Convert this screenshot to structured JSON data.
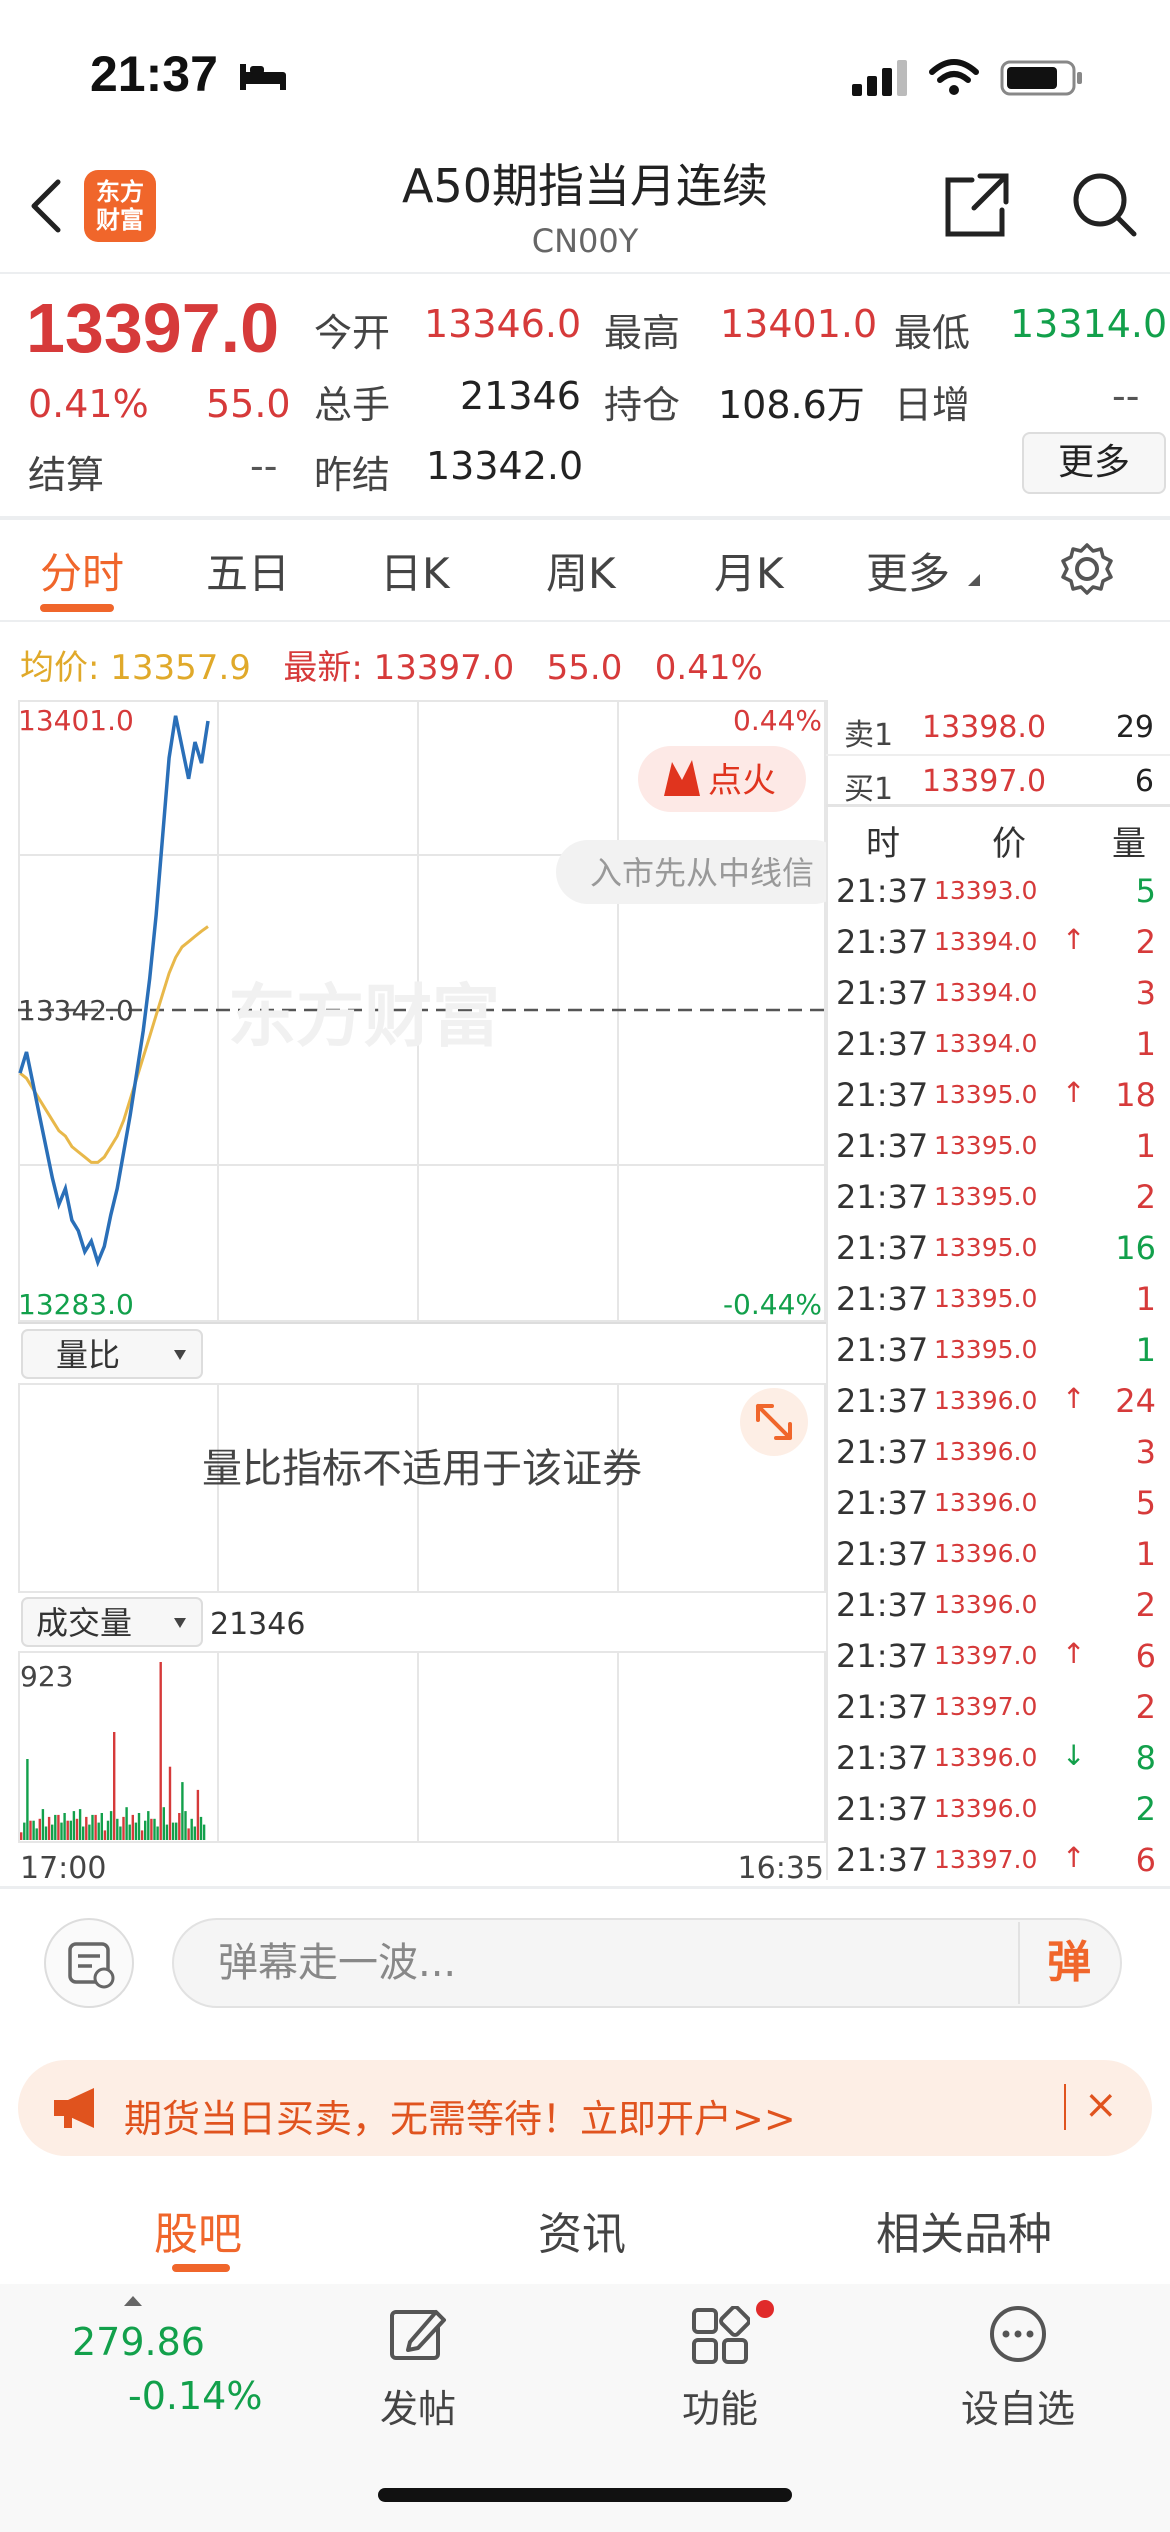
{
  "status_bar": {
    "time": "21:37"
  },
  "header": {
    "title": "A50期指当月连续",
    "code": "CN00Y",
    "logo_text_1": "东方",
    "logo_text_2": "财富"
  },
  "quote": {
    "last_price": "13397.0",
    "change_pct": "0.41%",
    "change": "55.0",
    "settle_label": "结算",
    "settle_value": "--",
    "open_label": "今开",
    "open_value": "13346.0",
    "high_label": "最高",
    "high_value": "13401.0",
    "low_label": "最低",
    "low_value": "13314.0",
    "volume_label": "总手",
    "volume_value": "21346",
    "oi_label": "持仓",
    "oi_value": "108.6万",
    "daily_inc_label": "日增",
    "daily_inc_value": "--",
    "prev_settle_label": "昨结",
    "prev_settle_value": "13342.0",
    "more_label": "更多"
  },
  "tabs": [
    "分时",
    "五日",
    "日K",
    "周K",
    "月K",
    "更多"
  ],
  "info_line": {
    "avg_label": "均价:",
    "avg_value": "13357.9",
    "latest_label": "最新:",
    "latest_value": "13397.0",
    "change": "55.0",
    "change_pct": "0.41%"
  },
  "chart": {
    "top_price": "13401.0",
    "bottom_price": "13283.0",
    "mid_price": "13342.0",
    "top_pct": "0.44%",
    "bottom_pct": "-0.44%",
    "fire_label": "点火",
    "ticker_text": "入市先从中线信",
    "watermark": "东方财富",
    "ratio_select": "量比",
    "ratio_message": "量比指标不适用于该证券",
    "volume_select": "成交量",
    "volume_total": "21346",
    "volume_max": "923",
    "time_start": "17:00",
    "time_end": "16:35"
  },
  "chart_data": {
    "type": "line",
    "title": "",
    "y_range": [
      13283.0,
      13401.0
    ],
    "reference": 13342.0,
    "series": [
      {
        "values": [
          13330,
          13334,
          13328,
          13322,
          13316,
          13310,
          13305,
          13308,
          13302,
          13300,
          13296,
          13298,
          13294,
          13297,
          13303,
          13308,
          13315,
          13322,
          13330,
          13338,
          13348,
          13360,
          13375,
          13390,
          13398,
          13392,
          13386,
          13393,
          13389,
          13397
        ]
      },
      {
        "values": [
          13330,
          13329,
          13327,
          13325,
          13323,
          13321,
          13319,
          13318,
          13316,
          13315,
          13314,
          13313,
          13313,
          13314,
          13316,
          13318,
          13321,
          13325,
          13329,
          13333,
          13337,
          13341,
          13345,
          13349,
          13352,
          13354,
          13355,
          13356,
          13357,
          13357.9
        ]
      }
    ],
    "volume_max": 923
  },
  "order_book": {
    "sell1_label": "卖1",
    "sell1_price": "13398.0",
    "sell1_qty": "29",
    "buy1_label": "买1",
    "buy1_price": "13397.0",
    "buy1_qty": "6",
    "col_time": "时",
    "col_price": "价",
    "col_qty": "量"
  },
  "trades": [
    {
      "time": "21:37",
      "price": "13393.0",
      "qty": "5",
      "dir": "",
      "qty_color": "#12a04b"
    },
    {
      "time": "21:37",
      "price": "13394.0",
      "qty": "2",
      "dir": "↑",
      "qty_color": "#d63a3a"
    },
    {
      "time": "21:37",
      "price": "13394.0",
      "qty": "3",
      "dir": "",
      "qty_color": "#d63a3a"
    },
    {
      "time": "21:37",
      "price": "13394.0",
      "qty": "1",
      "dir": "",
      "qty_color": "#d63a3a"
    },
    {
      "time": "21:37",
      "price": "13395.0",
      "qty": "18",
      "dir": "↑",
      "qty_color": "#d63a3a"
    },
    {
      "time": "21:37",
      "price": "13395.0",
      "qty": "1",
      "dir": "",
      "qty_color": "#d63a3a"
    },
    {
      "time": "21:37",
      "price": "13395.0",
      "qty": "2",
      "dir": "",
      "qty_color": "#d63a3a"
    },
    {
      "time": "21:37",
      "price": "13395.0",
      "qty": "16",
      "dir": "",
      "qty_color": "#12a04b"
    },
    {
      "time": "21:37",
      "price": "13395.0",
      "qty": "1",
      "dir": "",
      "qty_color": "#d63a3a"
    },
    {
      "time": "21:37",
      "price": "13395.0",
      "qty": "1",
      "dir": "",
      "qty_color": "#12a04b"
    },
    {
      "time": "21:37",
      "price": "13396.0",
      "qty": "24",
      "dir": "↑",
      "qty_color": "#d63a3a"
    },
    {
      "time": "21:37",
      "price": "13396.0",
      "qty": "3",
      "dir": "",
      "qty_color": "#d63a3a"
    },
    {
      "time": "21:37",
      "price": "13396.0",
      "qty": "5",
      "dir": "",
      "qty_color": "#d63a3a"
    },
    {
      "time": "21:37",
      "price": "13396.0",
      "qty": "1",
      "dir": "",
      "qty_color": "#d63a3a"
    },
    {
      "time": "21:37",
      "price": "13396.0",
      "qty": "2",
      "dir": "",
      "qty_color": "#d63a3a"
    },
    {
      "time": "21:37",
      "price": "13397.0",
      "qty": "6",
      "dir": "↑",
      "qty_color": "#d63a3a"
    },
    {
      "time": "21:37",
      "price": "13397.0",
      "qty": "2",
      "dir": "",
      "qty_color": "#d63a3a"
    },
    {
      "time": "21:37",
      "price": "13396.0",
      "qty": "8",
      "dir": "↓",
      "qty_color": "#12a04b"
    },
    {
      "time": "21:37",
      "price": "13396.0",
      "qty": "2",
      "dir": "",
      "qty_color": "#12a04b"
    },
    {
      "time": "21:37",
      "price": "13397.0",
      "qty": "6",
      "dir": "↑",
      "qty_color": "#d63a3a"
    }
  ],
  "danmaku": {
    "placeholder": "弹幕走一波...",
    "send_label": "弹"
  },
  "banner": {
    "text": "期货当日买卖，无需等待！立即开户>>",
    "close": "×"
  },
  "bottom_tabs": [
    "股吧",
    "资讯",
    "相关品种"
  ],
  "bottom_nav": {
    "index_value": "279.86",
    "index_change": "-0.14%",
    "post_label": "发帖",
    "func_label": "功能",
    "watch_label": "设自选"
  },
  "colors": {
    "up": "#d63a3a",
    "down": "#12a04b",
    "accent": "#f0662b",
    "avg_line": "#e8b84a",
    "price_line": "#2a6fb8"
  }
}
